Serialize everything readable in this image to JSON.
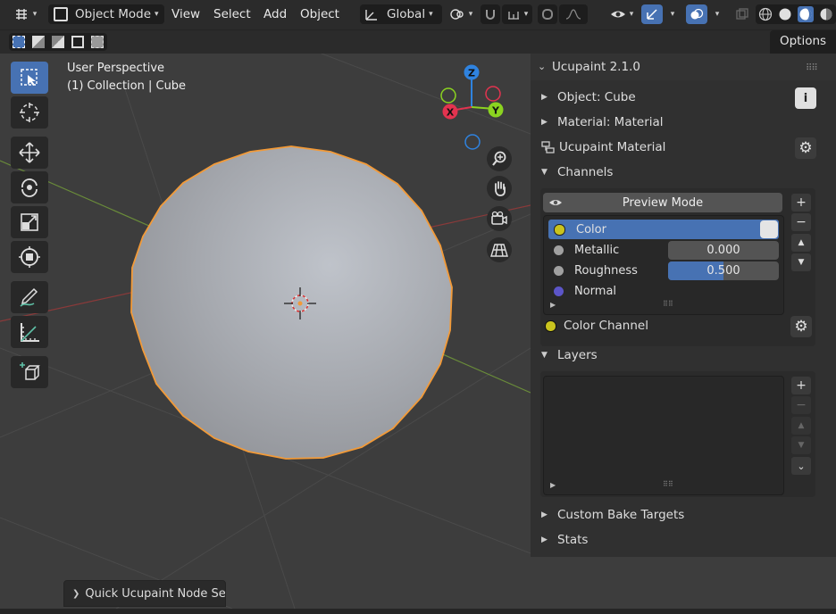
{
  "header": {
    "mode_label": "Object Mode",
    "menus": [
      "View",
      "Select",
      "Add",
      "Object"
    ],
    "transform_orientation": "Global",
    "options_label": "Options"
  },
  "viewport": {
    "view_name": "User Perspective",
    "collection_info": "(1) Collection | Cube",
    "gizmo_axes": {
      "z": "Z",
      "y": "Y",
      "x": "X"
    },
    "operator_panel": "Quick Ucupaint Node Setu"
  },
  "panel": {
    "title": "Ucupaint 2.1.0",
    "object_label": "Object: Cube",
    "material_label": "Material: Material",
    "ucupaint_material": "Ucupaint Material",
    "channels_label": "Channels",
    "preview_mode": "Preview Mode",
    "channels": [
      {
        "name": "Color",
        "color": "#c9c31e"
      },
      {
        "name": "Metallic",
        "value": "0.000",
        "fill": 0.0,
        "color": "#a0a0a0"
      },
      {
        "name": "Roughness",
        "value": "0.500",
        "fill": 0.5,
        "color": "#a0a0a0"
      },
      {
        "name": "Normal",
        "color": "#5c55c8"
      }
    ],
    "color_channel": "Color Channel",
    "layers_label": "Layers",
    "custom_bake_targets": "Custom Bake Targets",
    "stats": "Stats"
  },
  "colors": {
    "accent": "#4772b3",
    "selection_outline": "#f29a38",
    "axis_x": "#e3334f",
    "axis_y": "#8bd320",
    "axis_z": "#2f83e0"
  }
}
